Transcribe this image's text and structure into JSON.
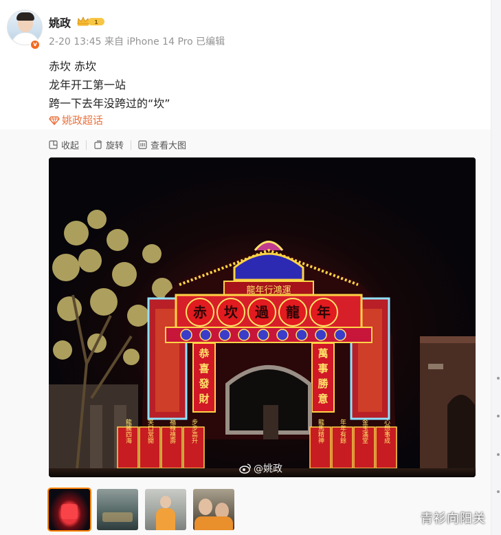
{
  "post": {
    "author": "姚政",
    "meta": "2-20 13:45  来自 iPhone 14 Pro  已编辑",
    "lines": [
      "赤坎 赤坎",
      "龙年开工第一站",
      "跨一下去年没跨过的“坎”"
    ],
    "topic": "姚政超话",
    "verified_symbol": "v"
  },
  "toolbar": {
    "collapse": "收起",
    "rotate": "旋转",
    "view_large": "查看大图"
  },
  "photo": {
    "watermark": "@姚政",
    "sign_top": "龍年行鴻運",
    "sign_main": [
      "赤",
      "坎",
      "過",
      "龍",
      "年"
    ],
    "sign_left": [
      "恭",
      "喜",
      "發",
      "財"
    ],
    "sign_right": [
      "萬",
      "事",
      "勝",
      "意"
    ],
    "panels_left": [
      "龍騰四海",
      "笑口常開",
      "福祿禧壽",
      "步步高升"
    ],
    "panels_right": [
      "龍馬精神",
      "年年有餘",
      "金玉滿堂",
      "心想事成"
    ]
  },
  "thumbnails": {
    "count": 4,
    "selected": 1
  },
  "overlay": {
    "corner_text": "青衫向阳关"
  },
  "colors": {
    "accent": "#eb7340",
    "badge": "#f26a21",
    "selected_thumb": "#ff8200"
  }
}
